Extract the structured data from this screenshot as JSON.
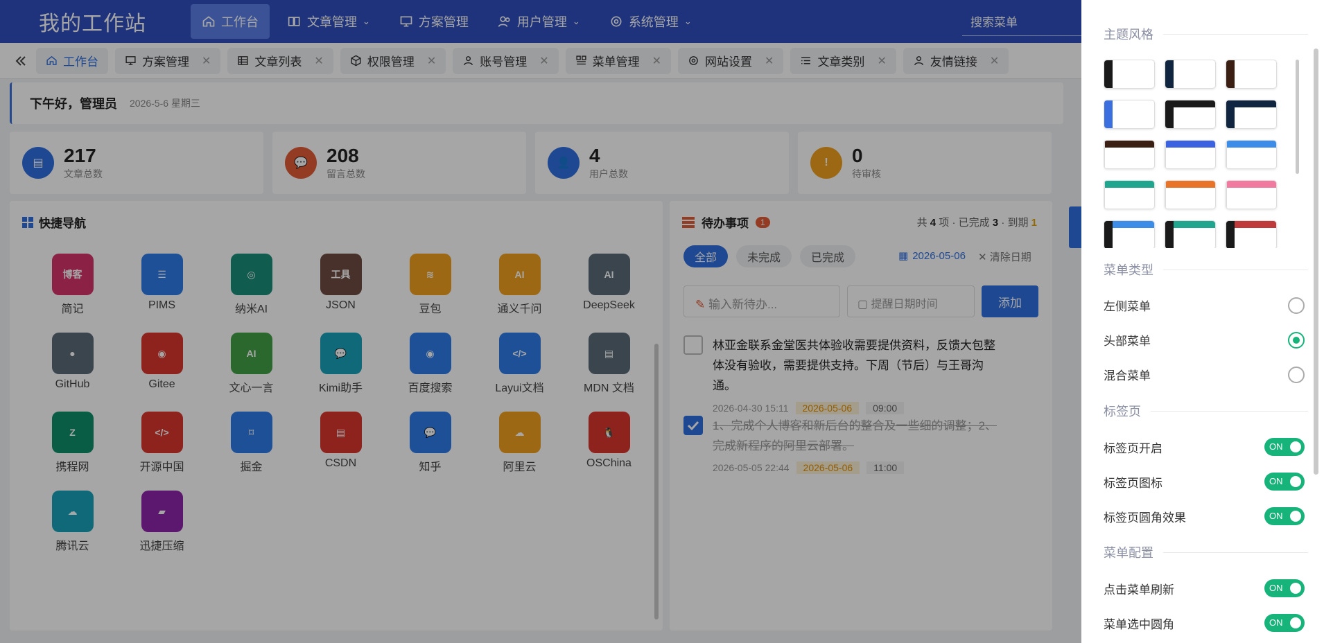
{
  "app": {
    "title": "我的工作站"
  },
  "topnav": [
    {
      "label": "工作台",
      "icon": "home-icon",
      "active": true
    },
    {
      "label": "文章管理",
      "icon": "book-icon",
      "chevron": true
    },
    {
      "label": "方案管理",
      "icon": "monitor-icon"
    },
    {
      "label": "用户管理",
      "icon": "users-icon",
      "chevron": true
    },
    {
      "label": "系统管理",
      "icon": "gear-icon",
      "chevron": true
    }
  ],
  "search": {
    "placeholder": "搜索菜单"
  },
  "tabs": [
    {
      "label": "工作台",
      "icon": "home-icon",
      "active": true,
      "closable": false
    },
    {
      "label": "方案管理",
      "icon": "monitor-icon",
      "closable": true
    },
    {
      "label": "文章列表",
      "icon": "table-icon",
      "closable": true
    },
    {
      "label": "权限管理",
      "icon": "cube-icon",
      "closable": true
    },
    {
      "label": "账号管理",
      "icon": "user-icon",
      "closable": true
    },
    {
      "label": "菜单管理",
      "icon": "menu-grid-icon",
      "closable": true
    },
    {
      "label": "网站设置",
      "icon": "gear-icon",
      "closable": true
    },
    {
      "label": "文章类别",
      "icon": "list-icon",
      "closable": true
    },
    {
      "label": "友情链接",
      "icon": "user-outline-icon",
      "closable": true
    }
  ],
  "greeting": {
    "hello": "下午好，管理员",
    "date": "2026-5-6 星期三"
  },
  "stats": [
    {
      "value": "217",
      "label": "文章总数",
      "color": "#2f6fe0",
      "icon": "doc-icon"
    },
    {
      "value": "208",
      "label": "留言总数",
      "color": "#e35b37",
      "icon": "chat-icon"
    },
    {
      "value": "4",
      "label": "用户总数",
      "color": "#2f6fe0",
      "icon": "user-icon"
    },
    {
      "value": "0",
      "label": "待审核",
      "color": "#f0a020",
      "icon": "alert-icon"
    }
  ],
  "quicknav": {
    "title": "快捷导航",
    "items": [
      {
        "label": "简记",
        "color": "#d8336c",
        "glyph": "博客"
      },
      {
        "label": "PIMS",
        "color": "#2f7be8",
        "glyph": "☰"
      },
      {
        "label": "纳米AI",
        "color": "#19907a",
        "glyph": "◎"
      },
      {
        "label": "JSON",
        "color": "#6d4c41",
        "glyph": "工具"
      },
      {
        "label": "豆包",
        "color": "#f0a020",
        "glyph": "≋"
      },
      {
        "label": "通义千问",
        "color": "#f0a020",
        "glyph": "AI"
      },
      {
        "label": "DeepSeek",
        "color": "#5a6b78",
        "glyph": "AI"
      },
      {
        "label": "GitHub",
        "color": "#5a6b78",
        "glyph": "●"
      },
      {
        "label": "Gitee",
        "color": "#d9362b",
        "glyph": "◉"
      },
      {
        "label": "文心一言",
        "color": "#43a047",
        "glyph": "AI"
      },
      {
        "label": "Kimi助手",
        "color": "#17a2b8",
        "glyph": "💬"
      },
      {
        "label": "百度搜索",
        "color": "#2f7be8",
        "glyph": "◉"
      },
      {
        "label": "Layui文档",
        "color": "#2f7be8",
        "glyph": "</>"
      },
      {
        "label": "MDN 文档",
        "color": "#5a6b78",
        "glyph": "▤"
      },
      {
        "label": "携程网",
        "color": "#0f8f6b",
        "glyph": "Z"
      },
      {
        "label": "开源中国",
        "color": "#d9362b",
        "glyph": "</>"
      },
      {
        "label": "掘金",
        "color": "#2f7be8",
        "glyph": "⌑"
      },
      {
        "label": "CSDN",
        "color": "#d9362b",
        "glyph": "▤"
      },
      {
        "label": "知乎",
        "color": "#2f7be8",
        "glyph": "💬"
      },
      {
        "label": "阿里云",
        "color": "#f0a020",
        "glyph": "☁"
      },
      {
        "label": "OSChina",
        "color": "#d9362b",
        "glyph": "🐧"
      },
      {
        "label": "腾讯云",
        "color": "#17a2b8",
        "glyph": "☁"
      },
      {
        "label": "迅捷压缩",
        "color": "#8e24aa",
        "glyph": "▰"
      }
    ]
  },
  "todo": {
    "title": "待办事项",
    "badge": "1",
    "summary": {
      "prefix": "共",
      "total": "4",
      "mid1": "项 · 已完成",
      "done": "3",
      "mid2": "· 到期",
      "due": "1"
    },
    "filters": [
      {
        "label": "全部",
        "active": true
      },
      {
        "label": "未完成"
      },
      {
        "label": "已完成"
      }
    ],
    "date_filter": "2026-05-06",
    "clear_date": "清除日期",
    "input_placeholder": "输入新待办...",
    "remind_placeholder": "提醒日期时间",
    "add_label": "添加",
    "items": [
      {
        "text": "林亚金联系金堂医共体验收需要提供资料，反馈大包整体没有验收，需要提供支持。下周（节后）与王哥沟通。",
        "done": false,
        "created": "2026-04-30 15:11",
        "due_date": "2026-05-06",
        "due_time": "09:00"
      },
      {
        "text": "1、完成个人博客和新后台的整合及一些细的调整；2、完成新程序的阿里云部署。",
        "done": true,
        "created": "2026-05-05 22:44",
        "due_date": "2026-05-06",
        "due_time": "11:00"
      }
    ]
  },
  "settings": {
    "theme_title": "主题风格",
    "themes": [
      {
        "side": "#1a1a1a",
        "top": ""
      },
      {
        "side": "#0f2540",
        "top": ""
      },
      {
        "side": "#3b1f12",
        "top": ""
      },
      {
        "side": "#3b6fe0",
        "top": ""
      },
      {
        "side": "#1a1a1a",
        "top": "#1a1a1a"
      },
      {
        "side": "#0f2540",
        "top": "#0f2540"
      },
      {
        "side": "",
        "top": "#3b1f12"
      },
      {
        "side": "",
        "top": "#3b62e0"
      },
      {
        "side": "",
        "top": "#3b8de8"
      },
      {
        "side": "",
        "top": "#20a58f"
      },
      {
        "side": "",
        "top": "#e8742a"
      },
      {
        "side": "",
        "top": "#f07aa0"
      },
      {
        "side": "#1a1a1a",
        "top": "#3b8de8"
      },
      {
        "side": "#1a1a1a",
        "top": "#20a58f"
      },
      {
        "side": "#1a1a1a",
        "top": "#c0393b"
      },
      {
        "side": "",
        "top": "#f07aa0"
      },
      {
        "side": "",
        "top": "#0f2540"
      },
      {
        "side": "",
        "top": "#e8742a"
      }
    ],
    "menu_type_title": "菜单类型",
    "menu_types": [
      {
        "label": "左侧菜单",
        "selected": false
      },
      {
        "label": "头部菜单",
        "selected": true
      },
      {
        "label": "混合菜单",
        "selected": false
      }
    ],
    "tabs_title": "标签页",
    "tab_options": [
      {
        "label": "标签页开启",
        "state": "ON"
      },
      {
        "label": "标签页图标",
        "state": "ON"
      },
      {
        "label": "标签页圆角效果",
        "state": "ON"
      }
    ],
    "menu_config_title": "菜单配置",
    "menu_options": [
      {
        "label": "点击菜单刷新",
        "state": "ON"
      },
      {
        "label": "菜单选中圆角",
        "state": "ON"
      }
    ]
  },
  "colors": {
    "header": "#2f4fbf",
    "accent": "#2f6fe0",
    "success": "#16b37a"
  }
}
